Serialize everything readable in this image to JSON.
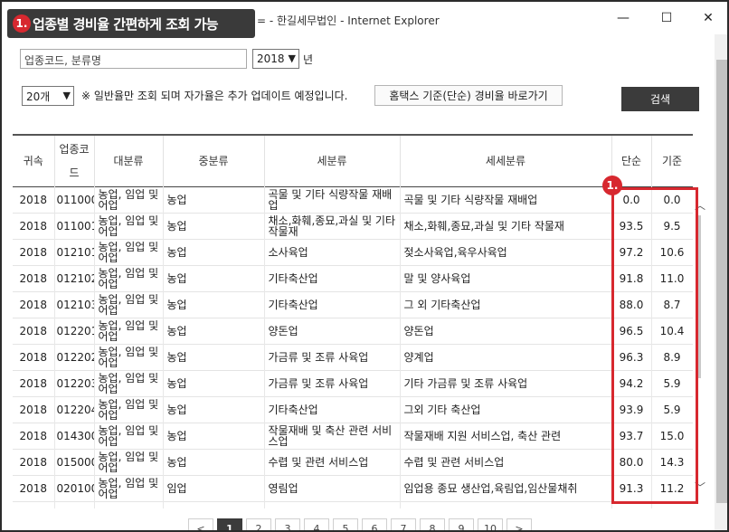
{
  "callout": {
    "number": "1.",
    "text": "업종별 경비율 간편하게 조회 가능"
  },
  "window": {
    "title": "= - 한길세무법인 - Internet Explorer",
    "minimize": "—",
    "maximize": "☐",
    "close": "✕"
  },
  "search": {
    "input_value": "업종코드, 분류명",
    "year": "2018",
    "year_suffix": "년"
  },
  "filter": {
    "page_size": "20개",
    "notice": "※ 일반율만 조회 되며 자가율은 추가 업데이트 예정입니다.",
    "hometax_button": "홈택스 기준(단순) 경비율 바로가기",
    "search_button": "검색"
  },
  "table": {
    "headers": [
      "귀속",
      "업종코드",
      "대분류",
      "중분류",
      "세분류",
      "세세분류",
      "단순",
      "기준"
    ],
    "rows": [
      {
        "year": "2018",
        "code": "011000",
        "major": "농업, 임업 및 어업",
        "mid": "농업",
        "sub": "곡물 및 기타 식량작물 재배업",
        "detail": "곡물 및 기타 식량작물 재배업",
        "simple": "0.0",
        "standard": "0.0"
      },
      {
        "year": "2018",
        "code": "011001",
        "major": "농업, 임업 및 어업",
        "mid": "농업",
        "sub": "채소,화훼,종묘,과실 및 기타 작물재",
        "detail": "채소,화훼,종묘,과실 및 기타 작물재",
        "simple": "93.5",
        "standard": "9.5"
      },
      {
        "year": "2018",
        "code": "012101",
        "major": "농업, 임업 및 어업",
        "mid": "농업",
        "sub": "소사육업",
        "detail": "젖소사육업,육우사육업",
        "simple": "97.2",
        "standard": "10.6"
      },
      {
        "year": "2018",
        "code": "012102",
        "major": "농업, 임업 및 어업",
        "mid": "농업",
        "sub": "기타축산업",
        "detail": "말 및 양사육업",
        "simple": "91.8",
        "standard": "11.0"
      },
      {
        "year": "2018",
        "code": "012103",
        "major": "농업, 임업 및 어업",
        "mid": "농업",
        "sub": "기타축산업",
        "detail": "그 외 기타축산업",
        "simple": "88.0",
        "standard": "8.7"
      },
      {
        "year": "2018",
        "code": "012201",
        "major": "농업, 임업 및 어업",
        "mid": "농업",
        "sub": "양돈업",
        "detail": "양돈업",
        "simple": "96.5",
        "standard": "10.4"
      },
      {
        "year": "2018",
        "code": "012202",
        "major": "농업, 임업 및 어업",
        "mid": "농업",
        "sub": "가금류 및 조류 사육업",
        "detail": "양계업",
        "simple": "96.3",
        "standard": "8.9"
      },
      {
        "year": "2018",
        "code": "012203",
        "major": "농업, 임업 및 어업",
        "mid": "농업",
        "sub": "가금류 및 조류 사육업",
        "detail": "기타 가금류 및 조류 사육업",
        "simple": "94.2",
        "standard": "5.9"
      },
      {
        "year": "2018",
        "code": "012204",
        "major": "농업, 임업 및 어업",
        "mid": "농업",
        "sub": "기타축산업",
        "detail": "그외 기타 축산업",
        "simple": "93.9",
        "standard": "5.9"
      },
      {
        "year": "2018",
        "code": "014300",
        "major": "농업, 임업 및 어업",
        "mid": "농업",
        "sub": "작물재배 및 축산 관련 서비스업",
        "detail": "작물재배 지원 서비스업, 축산 관련",
        "simple": "93.7",
        "standard": "15.0"
      },
      {
        "year": "2018",
        "code": "015000",
        "major": "농업, 임업 및 어업",
        "mid": "농업",
        "sub": "수렵 및 관련 서비스업",
        "detail": "수렵 및 관련 서비스업",
        "simple": "80.0",
        "standard": "14.3"
      },
      {
        "year": "2018",
        "code": "020100",
        "major": "농업, 임업 및 어업",
        "mid": "임업",
        "sub": "영림업",
        "detail": "임업용 종묘 생산업,육림업,임산물채취",
        "simple": "91.3",
        "standard": "11.2"
      },
      {
        "year": "",
        "code": "",
        "major": "농업, 임업",
        "mid": "",
        "sub": "",
        "detail": "",
        "simple": "",
        "standard": ""
      }
    ]
  },
  "badge": {
    "number": "1."
  },
  "pagination": {
    "prev": "<",
    "next": ">",
    "pages": [
      "1",
      "2",
      "3",
      "4",
      "5",
      "6",
      "7",
      "8",
      "9",
      "10"
    ],
    "active": "1"
  },
  "colors": {
    "accent": "#d7282f",
    "dark": "#3b3b3b"
  }
}
